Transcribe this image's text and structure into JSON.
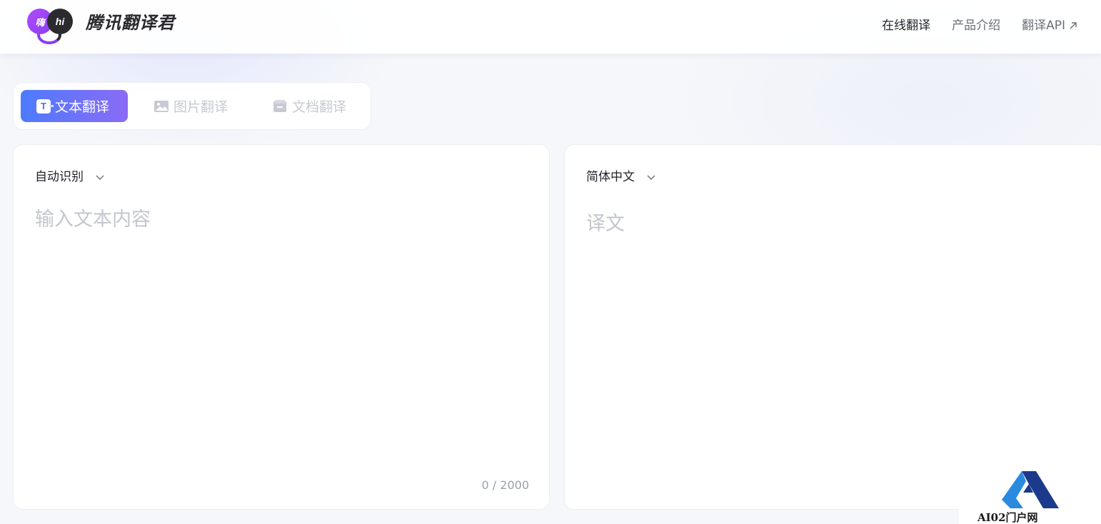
{
  "header": {
    "brand": "腾讯翻译君",
    "logo_bubble_left": "嗨",
    "logo_bubble_right": "hi",
    "nav": [
      {
        "label": "在线翻译"
      },
      {
        "label": "产品介绍"
      },
      {
        "label": "翻译API"
      }
    ]
  },
  "tabs": [
    {
      "label": "文本翻译",
      "icon": "text-translate-icon"
    },
    {
      "label": "图片翻译",
      "icon": "image-icon"
    },
    {
      "label": "文档翻译",
      "icon": "document-icon"
    }
  ],
  "source": {
    "language": "自动识别",
    "placeholder": "输入文本内容",
    "value": "",
    "counter": "0 / 2000"
  },
  "target": {
    "language": "简体中文",
    "placeholder": "译文"
  },
  "watermark": {
    "text": "AI02门户网"
  },
  "colors": {
    "accent_start": "#4d7bff",
    "accent_end": "#8a6bf5",
    "placeholder": "#c3c6cd",
    "nav_active": "#1f2329",
    "nav_inactive": "#6b7077"
  }
}
